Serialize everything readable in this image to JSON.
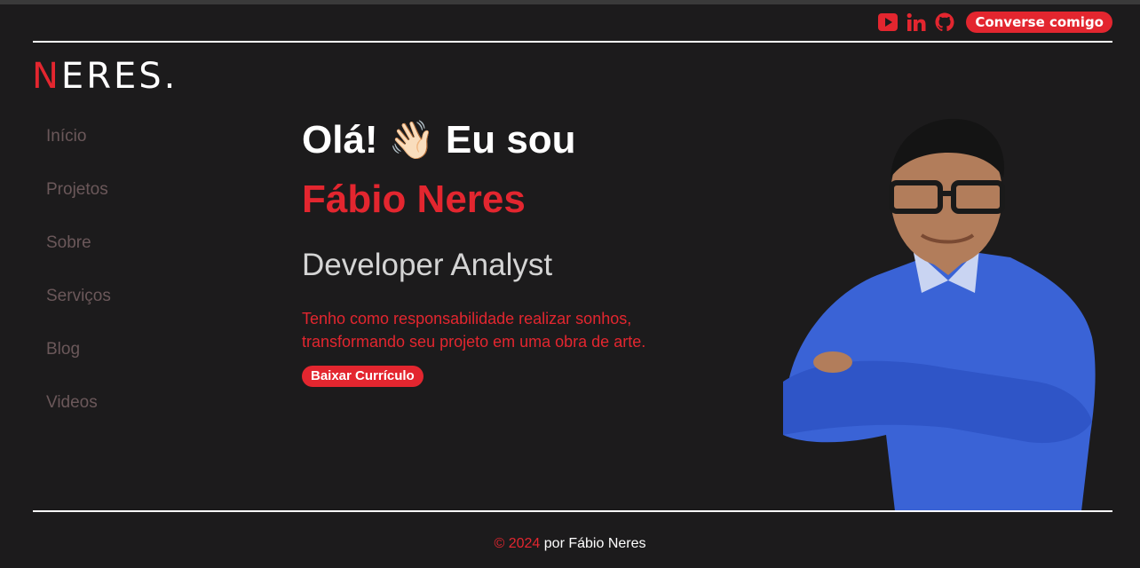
{
  "header": {
    "social_icons": [
      "youtube-icon",
      "linkedin-icon",
      "github-icon"
    ],
    "cta_label": "Converse comigo"
  },
  "logo": {
    "first_letter": "N",
    "rest": "ERES."
  },
  "sidebar": {
    "items": [
      {
        "label": "Início"
      },
      {
        "label": "Projetos"
      },
      {
        "label": "Sobre"
      },
      {
        "label": "Serviços"
      },
      {
        "label": "Blog"
      },
      {
        "label": "Videos"
      }
    ]
  },
  "hero": {
    "greeting_before": "Olá!",
    "wave_emoji": "👋🏻",
    "greeting_after": "Eu sou",
    "name": "Fábio Neres",
    "role": "Developer Analyst",
    "tagline_line1": "Tenho como responsabilidade realizar sonhos,",
    "tagline_line2": "transformando seu projeto em uma obra de arte.",
    "cv_button": "Baixar Currículo"
  },
  "footer": {
    "copyright": "© 2024",
    "credit": "por Fábio Neres"
  },
  "colors": {
    "accent": "#e3262f",
    "background": "#1c1b1c",
    "nav_text": "#6b585a",
    "role_text": "#d4d4d4"
  }
}
